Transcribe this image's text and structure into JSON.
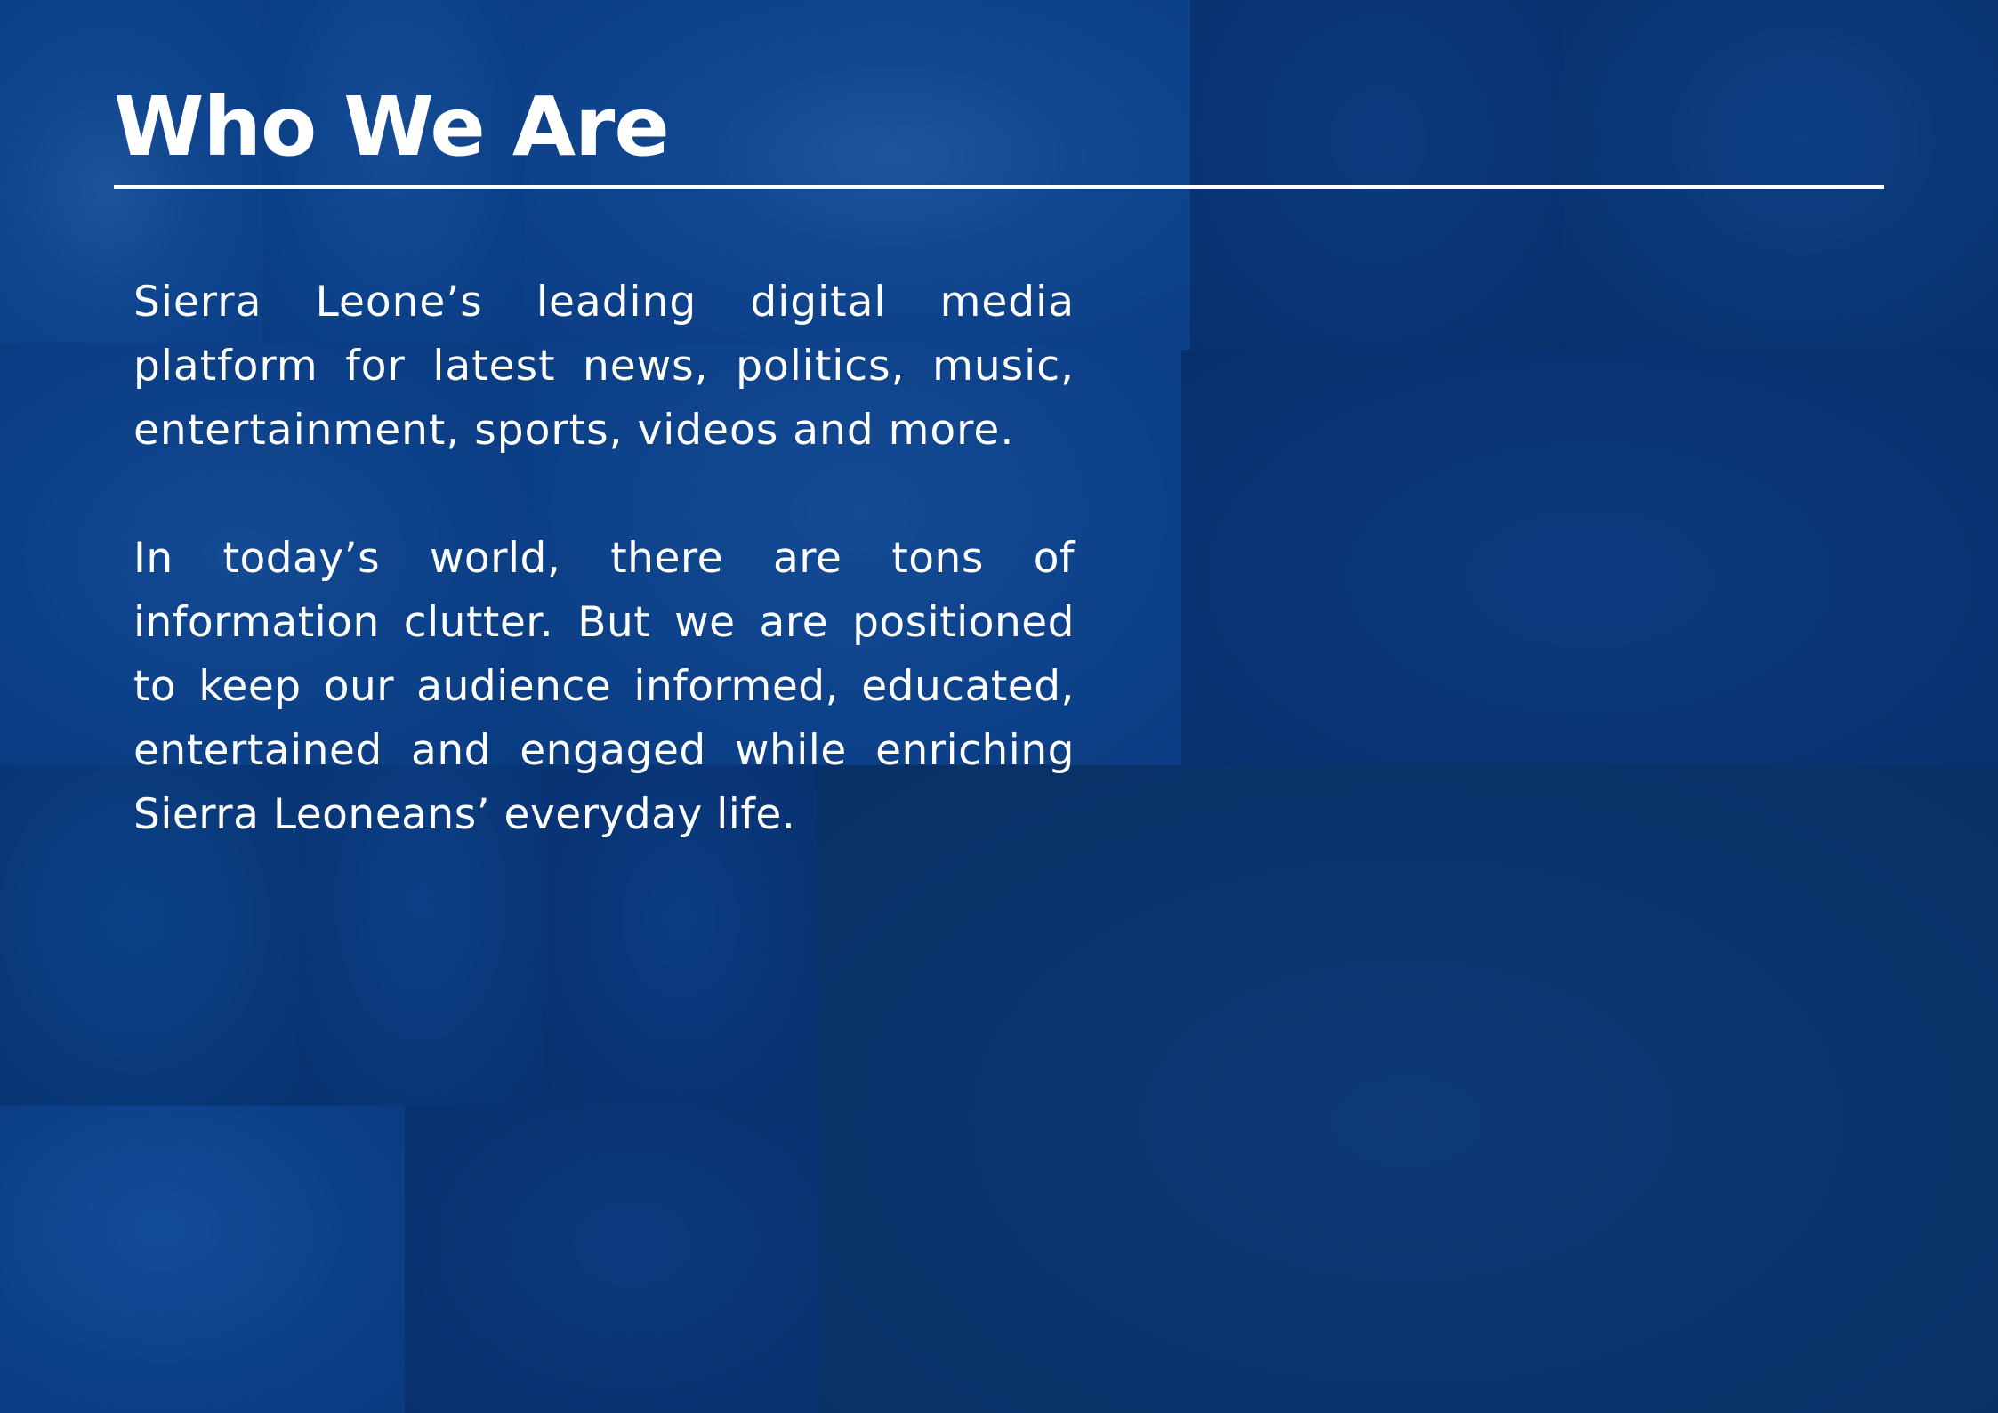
{
  "page": {
    "title": "Who We Are",
    "paragraphs": [
      "Sierra Leone’s leading digital media platform for latest news, politics, music, entertainment, sports, videos and more.",
      "In today’s world, there are tons of information clutter. But we are positioned to keep our audience informed, educated, entertained and engaged while enriching Sierra Leoneans’ everyday life."
    ]
  },
  "colors": {
    "overlay": "#0b3f86",
    "text": "#ffffff"
  }
}
